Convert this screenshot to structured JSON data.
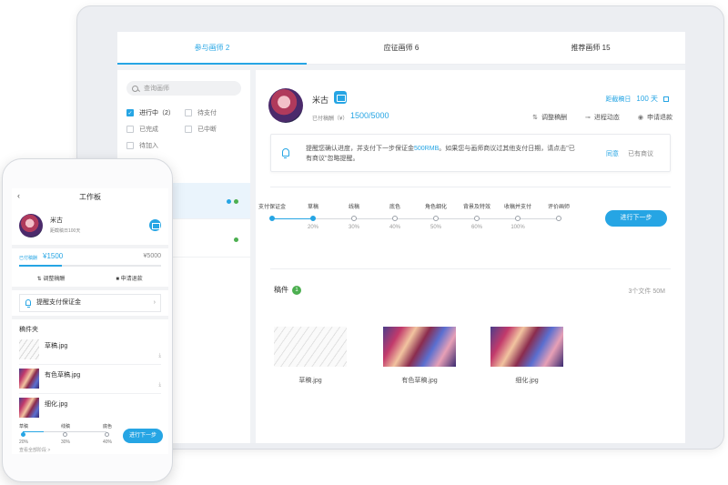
{
  "desktop": {
    "tabs": [
      "参与画师 2",
      "应征画师 6",
      "推荐画师 15"
    ],
    "search_placeholder": "查询画师",
    "filters": [
      {
        "label": "进行中（2）",
        "checked": true
      },
      {
        "label": "待支付",
        "checked": false
      },
      {
        "label": "已完成",
        "checked": false
      },
      {
        "label": "已中断",
        "checked": false
      },
      {
        "label": "待加入",
        "checked": false
      }
    ],
    "artist": {
      "name": "米古",
      "fee_label": "已付稿酬（¥）",
      "fee_value": "1500/5000",
      "deadline_label": "距截稿日",
      "deadline_days": "100 天"
    },
    "actions": {
      "adjust": "调整稿酬",
      "progress": "进程动态",
      "refund": "申请退款"
    },
    "notice": {
      "text_before": "提醒您确认进度，并支付下一步保证金",
      "amount": "500RMB",
      "text_after": "。如果您与画师商议过其他支付日期，请点击\"已有商议\"忽略提醒。",
      "agree": "同意",
      "disagree": "已有商议"
    },
    "steps": [
      {
        "label": "支付保证金",
        "pct": "",
        "done": true
      },
      {
        "label": "草稿",
        "pct": "20%",
        "done": true
      },
      {
        "label": "线稿",
        "pct": "30%",
        "done": false
      },
      {
        "label": "底色",
        "pct": "40%",
        "done": false
      },
      {
        "label": "角色细化",
        "pct": "50%",
        "done": false
      },
      {
        "label": "背景及特效",
        "pct": "60%",
        "done": false
      },
      {
        "label": "收稿并支付",
        "pct": "100%",
        "done": false
      },
      {
        "label": "评价画师",
        "pct": "",
        "done": false
      }
    ],
    "next_button": "进行下一步",
    "files": {
      "title": "稿件",
      "badge": "1",
      "count": "3个文件 50M",
      "items": [
        {
          "name": "草稿.jpg",
          "thumb": "sketch"
        },
        {
          "name": "有色草稿.jpg",
          "thumb": "art"
        },
        {
          "name": "细化.jpg",
          "thumb": "art"
        }
      ]
    }
  },
  "mobile": {
    "title": "工作板",
    "artist_name": "米古",
    "deadline": "距截稿日100天",
    "fee_label": "已付稿酬",
    "fee_paid": "¥1500",
    "fee_total": "¥5000",
    "fee_progress": 0.3,
    "actions": {
      "adjust": "调整稿酬",
      "refund": "申请退款"
    },
    "remind": "提醒支付保证金",
    "folder": "稿件夹",
    "files": [
      {
        "name": "草稿.jpg",
        "thumb": "sketch"
      },
      {
        "name": "有色草稿.jpg",
        "thumb": "art"
      },
      {
        "name": "细化.jpg",
        "thumb": "art"
      }
    ],
    "steps": [
      {
        "label": "草稿",
        "pct": "20%",
        "done": true
      },
      {
        "label": "线稿",
        "pct": "30%",
        "done": false
      },
      {
        "label": "底色",
        "pct": "40%",
        "done": false
      }
    ],
    "view_all": "查看全部阶段 >",
    "next_button": "进行下一步"
  },
  "colors": {
    "accent": "#26a5e4",
    "success": "#4caf50"
  }
}
